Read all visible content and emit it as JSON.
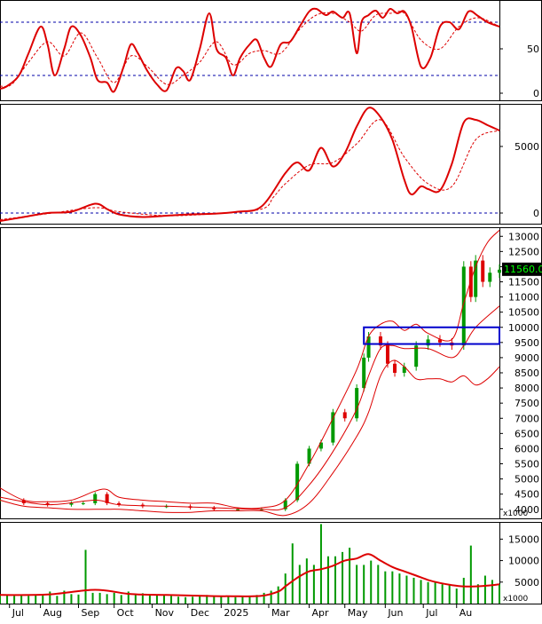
{
  "chart_data": [
    {
      "type": "line",
      "panel": "oscillator-top",
      "yticks": [
        0,
        50
      ],
      "reference_levels": [
        20,
        80
      ],
      "ylim": [
        -8,
        105
      ],
      "series": [
        {
          "role": "main",
          "color": "#dd0000",
          "x": [
            0,
            3,
            8,
            12,
            17,
            20,
            23,
            27,
            30,
            34,
            38,
            41,
            45,
            48,
            52,
            55,
            58,
            62,
            66,
            70,
            74,
            77,
            80,
            84,
            88,
            91,
            95,
            98,
            101,
            105,
            108,
            111,
            114,
            118,
            122,
            126,
            130,
            133,
            137,
            140,
            144,
            147,
            150,
            152,
            155,
            158,
            161,
            164,
            167,
            170,
            173,
            177,
            181,
            185,
            189,
            193,
            197,
            201,
            205,
            210
          ],
          "y": [
            5,
            8,
            20,
            45,
            75,
            55,
            20,
            50,
            75,
            65,
            40,
            15,
            12,
            2,
            30,
            55,
            45,
            25,
            10,
            3,
            28,
            25,
            15,
            50,
            90,
            50,
            40,
            20,
            40,
            55,
            60,
            40,
            30,
            55,
            58,
            75,
            92,
            95,
            88,
            92,
            85,
            90,
            45,
            80,
            88,
            93,
            85,
            95,
            90,
            92,
            75,
            30,
            40,
            75,
            80,
            72,
            92,
            87,
            80,
            75
          ]
        },
        {
          "role": "signal",
          "color": "#dd0000",
          "dashed": true,
          "x": [
            0,
            5,
            12,
            20,
            27,
            34,
            41,
            48,
            55,
            62,
            70,
            77,
            84,
            91,
            98,
            105,
            111,
            118,
            126,
            133,
            140,
            147,
            152,
            158,
            164,
            170,
            177,
            185,
            193,
            201,
            210
          ],
          "y": [
            8,
            10,
            35,
            58,
            42,
            68,
            40,
            12,
            42,
            30,
            10,
            20,
            35,
            58,
            32,
            45,
            48,
            45,
            72,
            88,
            90,
            80,
            70,
            88,
            90,
            90,
            60,
            50,
            75,
            85,
            75
          ]
        }
      ]
    },
    {
      "type": "line",
      "panel": "macd",
      "yticks": [
        0,
        5000
      ],
      "reference_levels": [
        0
      ],
      "ylim": [
        -800,
        8200
      ],
      "series": [
        {
          "role": "main",
          "color": "#dd0000",
          "x": [
            0,
            10,
            20,
            30,
            40,
            45,
            50,
            60,
            70,
            80,
            90,
            100,
            110,
            120,
            125,
            130,
            135,
            140,
            145,
            150,
            155,
            160,
            165,
            170,
            173,
            177,
            180,
            185,
            190,
            195,
            200,
            205,
            210
          ],
          "y": [
            -600,
            -300,
            0,
            100,
            700,
            300,
            -100,
            -300,
            -200,
            -100,
            -50,
            100,
            500,
            3000,
            3800,
            3200,
            4900,
            3500,
            4500,
            6500,
            7900,
            7200,
            5500,
            2500,
            1400,
            2000,
            1800,
            1700,
            3700,
            6800,
            7000,
            6600,
            6200
          ]
        },
        {
          "role": "signal",
          "color": "#dd0000",
          "dashed": true,
          "x": [
            0,
            20,
            40,
            50,
            70,
            90,
            110,
            115,
            120,
            130,
            140,
            150,
            160,
            170,
            180,
            190,
            200,
            210
          ],
          "y": [
            -500,
            -50,
            400,
            100,
            -200,
            -50,
            300,
            1200,
            2200,
            3600,
            3800,
            5200,
            7000,
            4200,
            2200,
            2000,
            5500,
            6200
          ]
        }
      ]
    },
    {
      "type": "line",
      "panel": "price",
      "yticks": [
        4000,
        4500,
        5000,
        5500,
        6000,
        6500,
        7000,
        7500,
        8000,
        8500,
        9000,
        9500,
        10000,
        10500,
        11000,
        11500,
        12000,
        12500,
        13000
      ],
      "ylim": [
        3700,
        13300
      ],
      "last_value_label": "11560.0",
      "unit_label": "x1000",
      "series": [
        {
          "role": "close",
          "color": "#009900",
          "x": [
            0,
            10,
            20,
            30,
            35,
            40,
            45,
            50,
            60,
            70,
            80,
            90,
            100,
            110,
            120,
            125,
            130,
            135,
            140,
            145,
            150,
            153,
            155,
            160,
            163,
            166,
            170,
            175,
            180,
            185,
            190,
            195,
            198,
            200,
            203,
            206,
            210
          ],
          "y": [
            4300,
            4200,
            4150,
            4200,
            4200,
            4500,
            4200,
            4150,
            4100,
            4100,
            4050,
            4000,
            4000,
            4000,
            4300,
            5500,
            6000,
            6200,
            7200,
            7000,
            8000,
            9000,
            9700,
            9400,
            8800,
            8500,
            8700,
            9400,
            9600,
            9500,
            9400,
            12000,
            11000,
            12200,
            11500,
            11800,
            11900
          ]
        },
        {
          "role": "upper-band",
          "color": "#dd0000",
          "x": [
            0,
            10,
            20,
            30,
            40,
            45,
            50,
            60,
            70,
            80,
            90,
            100,
            110,
            120,
            130,
            140,
            150,
            155,
            160,
            165,
            170,
            175,
            180,
            190,
            195,
            200,
            205,
            210
          ],
          "y": [
            4700,
            4300,
            4250,
            4300,
            4600,
            4650,
            4400,
            4300,
            4250,
            4200,
            4200,
            4050,
            4050,
            4300,
            5500,
            7000,
            8600,
            9700,
            10100,
            10200,
            9900,
            10100,
            9800,
            9600,
            10800,
            12000,
            12800,
            13200
          ]
        },
        {
          "role": "lower-band",
          "color": "#dd0000",
          "x": [
            0,
            10,
            20,
            30,
            40,
            45,
            50,
            60,
            70,
            80,
            90,
            100,
            110,
            120,
            130,
            140,
            150,
            155,
            160,
            165,
            170,
            175,
            180,
            185,
            190,
            195,
            200,
            205,
            210
          ],
          "y": [
            4300,
            4100,
            4050,
            4000,
            4000,
            4000,
            4000,
            3950,
            3900,
            3900,
            3950,
            3950,
            3950,
            3800,
            4200,
            5200,
            6400,
            7200,
            8400,
            8900,
            8700,
            8300,
            8300,
            8300,
            8200,
            8400,
            8100,
            8300,
            8700
          ]
        },
        {
          "role": "middle-band",
          "color": "#dd0000",
          "x": [
            0,
            20,
            40,
            50,
            70,
            90,
            110,
            120,
            130,
            140,
            150,
            155,
            160,
            165,
            170,
            180,
            190,
            195,
            200,
            210
          ],
          "y": [
            4400,
            4150,
            4300,
            4150,
            4100,
            4050,
            4000,
            4050,
            4800,
            5900,
            7300,
            8400,
            9300,
            9400,
            9300,
            9300,
            9000,
            9400,
            10000,
            10700
          ]
        }
      ],
      "annotations": [
        {
          "type": "rectangle",
          "color": "#0000cc",
          "x": [
            153,
            210
          ],
          "y": [
            9450,
            10000
          ]
        }
      ]
    },
    {
      "type": "bar",
      "panel": "volume",
      "yticks": [
        5000,
        10000,
        15000
      ],
      "ylim": [
        0,
        19000
      ],
      "unit_label": "x1000",
      "x_tick_labels": [
        "Jul",
        "Aug",
        "Sep",
        "Oct",
        "Nov",
        "Dec",
        "2025",
        "Mar",
        "Apr",
        "May",
        "Jun",
        "Jul",
        "Au"
      ],
      "x_tick_positions": [
        4,
        17,
        33,
        48,
        64,
        79,
        93,
        113,
        130,
        145,
        162,
        178,
        192
      ],
      "series": [
        {
          "role": "volume",
          "color": "#009900",
          "x": [
            0,
            3,
            6,
            9,
            12,
            15,
            18,
            21,
            24,
            27,
            30,
            33,
            36,
            39,
            42,
            45,
            48,
            51,
            54,
            57,
            60,
            63,
            66,
            69,
            72,
            75,
            78,
            81,
            84,
            87,
            90,
            93,
            96,
            99,
            102,
            105,
            108,
            111,
            114,
            117,
            120,
            123,
            126,
            129,
            132,
            135,
            138,
            141,
            144,
            147,
            150,
            153,
            156,
            159,
            162,
            165,
            168,
            171,
            174,
            177,
            180,
            183,
            186,
            189,
            192,
            195,
            198,
            201,
            204,
            207,
            210
          ],
          "y": [
            2000,
            2100,
            1800,
            2000,
            1800,
            2100,
            2000,
            2800,
            1800,
            3000,
            2200,
            2100,
            12500,
            2500,
            2500,
            2200,
            2500,
            2000,
            2800,
            2000,
            2400,
            2200,
            2000,
            2000,
            1800,
            1600,
            1500,
            1600,
            1800,
            2000,
            1800,
            1600,
            1800,
            1500,
            1700,
            1600,
            2000,
            2500,
            3000,
            4000,
            7000,
            14000,
            9000,
            10500,
            9000,
            18500,
            11000,
            11000,
            12000,
            13000,
            9000,
            9000,
            10000,
            9000,
            7500,
            7500,
            7000,
            6500,
            6000,
            5500,
            5000,
            5000,
            4500,
            4500,
            3500,
            6000,
            13500,
            4500,
            6500,
            5500,
            4500
          ]
        },
        {
          "role": "volume-ma",
          "color": "#dd0000",
          "x": [
            0,
            20,
            40,
            55,
            70,
            85,
            100,
            110,
            117,
            120,
            125,
            130,
            135,
            140,
            145,
            150,
            155,
            160,
            165,
            170,
            175,
            180,
            185,
            190,
            195,
            200,
            205,
            210
          ],
          "y": [
            2000,
            2100,
            3200,
            2200,
            2000,
            1800,
            1700,
            1800,
            2800,
            4000,
            6000,
            7500,
            8000,
            8800,
            10000,
            10500,
            11500,
            10000,
            8500,
            7500,
            6500,
            5500,
            4800,
            4300,
            4000,
            4000,
            4200,
            4500
          ]
        }
      ]
    }
  ]
}
